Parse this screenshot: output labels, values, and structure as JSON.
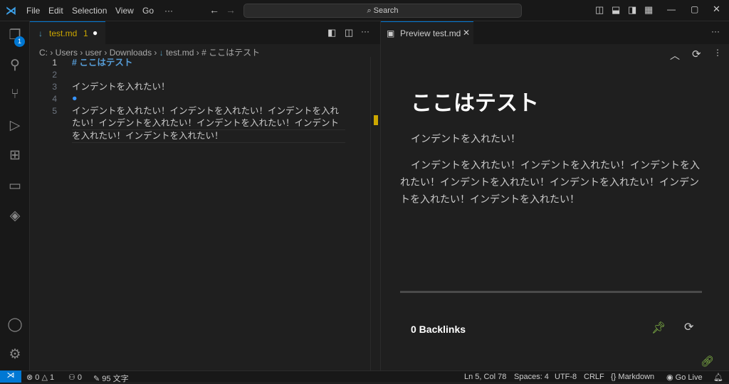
{
  "menu": [
    "File",
    "Edit",
    "Selection",
    "View",
    "Go",
    "···"
  ],
  "search_label": "Search",
  "explorer_badge": "1",
  "tab": {
    "label": "test.md",
    "problems": "1"
  },
  "breadcrumb": [
    "C:",
    "Users",
    "user",
    "Downloads",
    "test.md",
    "# ここはテスト"
  ],
  "lines": [
    {
      "n": "1",
      "text": "# ここはテスト"
    },
    {
      "n": "2",
      "text": ""
    },
    {
      "n": "3",
      "text": "インデントを入れたい！"
    },
    {
      "n": "4",
      "text": ""
    },
    {
      "n": "5",
      "text": "インデントを入れたい！インデントを入れたい！インデントを入れたい！インデントを入れたい！インデントを入れたい！インデントを入れたい！インデントを入れたい！"
    }
  ],
  "line5_wrapped": [
    "インデントを入れたい！インデントを入れたい！インデントを入れ",
    "たい！インデントを入れたい！インデントを入れたい！インデント",
    "を入れたい！インデントを入れたい！"
  ],
  "preview": {
    "tab": "Preview test.md",
    "heading": "ここはテスト",
    "p1": "インデントを入れたい！",
    "p2": "インデントを入れたい！インデントを入れたい！インデントを入れたい！インデントを入れたい！インデントを入れたい！インデントを入れたい！インデントを入れたい！",
    "backlinks": "0 Backlinks"
  },
  "status": {
    "errors": "0",
    "warnings": "1",
    "ports": "0",
    "chars": "95 文字",
    "position": "Ln 5, Col 78",
    "spaces": "Spaces: 4",
    "encoding": "UTF-8",
    "eol": "CRLF",
    "language": "Markdown",
    "golive": "Go Live"
  }
}
